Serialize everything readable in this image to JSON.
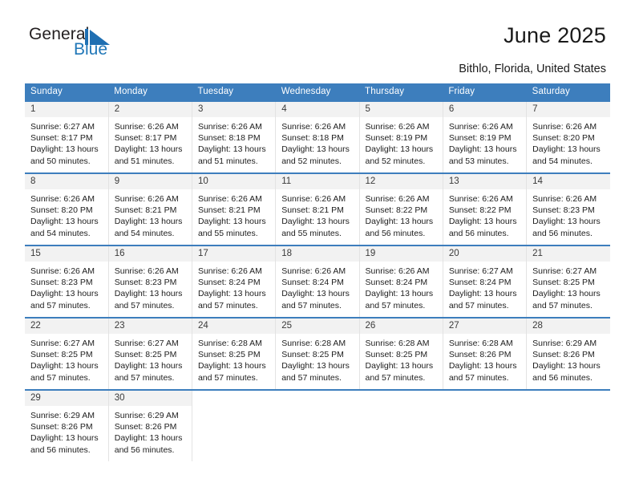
{
  "brand": {
    "word_general": "General",
    "word_blue": "Blue",
    "logo_icon": "triangle-flag-icon",
    "blue_hex": "#2077b8"
  },
  "header": {
    "title": "June 2025",
    "location": "Bithlo, Florida, United States",
    "header_bg_hex": "#3d7ebd",
    "daynum_bg_hex": "#f2f2f2"
  },
  "weekday_headers": [
    "Sunday",
    "Monday",
    "Tuesday",
    "Wednesday",
    "Thursday",
    "Friday",
    "Saturday"
  ],
  "weeks": [
    [
      {
        "day": "1",
        "sunrise": "Sunrise: 6:27 AM",
        "sunset": "Sunset: 8:17 PM",
        "daylight_1": "Daylight: 13 hours",
        "daylight_2": "and 50 minutes."
      },
      {
        "day": "2",
        "sunrise": "Sunrise: 6:26 AM",
        "sunset": "Sunset: 8:17 PM",
        "daylight_1": "Daylight: 13 hours",
        "daylight_2": "and 51 minutes."
      },
      {
        "day": "3",
        "sunrise": "Sunrise: 6:26 AM",
        "sunset": "Sunset: 8:18 PM",
        "daylight_1": "Daylight: 13 hours",
        "daylight_2": "and 51 minutes."
      },
      {
        "day": "4",
        "sunrise": "Sunrise: 6:26 AM",
        "sunset": "Sunset: 8:18 PM",
        "daylight_1": "Daylight: 13 hours",
        "daylight_2": "and 52 minutes."
      },
      {
        "day": "5",
        "sunrise": "Sunrise: 6:26 AM",
        "sunset": "Sunset: 8:19 PM",
        "daylight_1": "Daylight: 13 hours",
        "daylight_2": "and 52 minutes."
      },
      {
        "day": "6",
        "sunrise": "Sunrise: 6:26 AM",
        "sunset": "Sunset: 8:19 PM",
        "daylight_1": "Daylight: 13 hours",
        "daylight_2": "and 53 minutes."
      },
      {
        "day": "7",
        "sunrise": "Sunrise: 6:26 AM",
        "sunset": "Sunset: 8:20 PM",
        "daylight_1": "Daylight: 13 hours",
        "daylight_2": "and 54 minutes."
      }
    ],
    [
      {
        "day": "8",
        "sunrise": "Sunrise: 6:26 AM",
        "sunset": "Sunset: 8:20 PM",
        "daylight_1": "Daylight: 13 hours",
        "daylight_2": "and 54 minutes."
      },
      {
        "day": "9",
        "sunrise": "Sunrise: 6:26 AM",
        "sunset": "Sunset: 8:21 PM",
        "daylight_1": "Daylight: 13 hours",
        "daylight_2": "and 54 minutes."
      },
      {
        "day": "10",
        "sunrise": "Sunrise: 6:26 AM",
        "sunset": "Sunset: 8:21 PM",
        "daylight_1": "Daylight: 13 hours",
        "daylight_2": "and 55 minutes."
      },
      {
        "day": "11",
        "sunrise": "Sunrise: 6:26 AM",
        "sunset": "Sunset: 8:21 PM",
        "daylight_1": "Daylight: 13 hours",
        "daylight_2": "and 55 minutes."
      },
      {
        "day": "12",
        "sunrise": "Sunrise: 6:26 AM",
        "sunset": "Sunset: 8:22 PM",
        "daylight_1": "Daylight: 13 hours",
        "daylight_2": "and 56 minutes."
      },
      {
        "day": "13",
        "sunrise": "Sunrise: 6:26 AM",
        "sunset": "Sunset: 8:22 PM",
        "daylight_1": "Daylight: 13 hours",
        "daylight_2": "and 56 minutes."
      },
      {
        "day": "14",
        "sunrise": "Sunrise: 6:26 AM",
        "sunset": "Sunset: 8:23 PM",
        "daylight_1": "Daylight: 13 hours",
        "daylight_2": "and 56 minutes."
      }
    ],
    [
      {
        "day": "15",
        "sunrise": "Sunrise: 6:26 AM",
        "sunset": "Sunset: 8:23 PM",
        "daylight_1": "Daylight: 13 hours",
        "daylight_2": "and 57 minutes."
      },
      {
        "day": "16",
        "sunrise": "Sunrise: 6:26 AM",
        "sunset": "Sunset: 8:23 PM",
        "daylight_1": "Daylight: 13 hours",
        "daylight_2": "and 57 minutes."
      },
      {
        "day": "17",
        "sunrise": "Sunrise: 6:26 AM",
        "sunset": "Sunset: 8:24 PM",
        "daylight_1": "Daylight: 13 hours",
        "daylight_2": "and 57 minutes."
      },
      {
        "day": "18",
        "sunrise": "Sunrise: 6:26 AM",
        "sunset": "Sunset: 8:24 PM",
        "daylight_1": "Daylight: 13 hours",
        "daylight_2": "and 57 minutes."
      },
      {
        "day": "19",
        "sunrise": "Sunrise: 6:26 AM",
        "sunset": "Sunset: 8:24 PM",
        "daylight_1": "Daylight: 13 hours",
        "daylight_2": "and 57 minutes."
      },
      {
        "day": "20",
        "sunrise": "Sunrise: 6:27 AM",
        "sunset": "Sunset: 8:24 PM",
        "daylight_1": "Daylight: 13 hours",
        "daylight_2": "and 57 minutes."
      },
      {
        "day": "21",
        "sunrise": "Sunrise: 6:27 AM",
        "sunset": "Sunset: 8:25 PM",
        "daylight_1": "Daylight: 13 hours",
        "daylight_2": "and 57 minutes."
      }
    ],
    [
      {
        "day": "22",
        "sunrise": "Sunrise: 6:27 AM",
        "sunset": "Sunset: 8:25 PM",
        "daylight_1": "Daylight: 13 hours",
        "daylight_2": "and 57 minutes."
      },
      {
        "day": "23",
        "sunrise": "Sunrise: 6:27 AM",
        "sunset": "Sunset: 8:25 PM",
        "daylight_1": "Daylight: 13 hours",
        "daylight_2": "and 57 minutes."
      },
      {
        "day": "24",
        "sunrise": "Sunrise: 6:28 AM",
        "sunset": "Sunset: 8:25 PM",
        "daylight_1": "Daylight: 13 hours",
        "daylight_2": "and 57 minutes."
      },
      {
        "day": "25",
        "sunrise": "Sunrise: 6:28 AM",
        "sunset": "Sunset: 8:25 PM",
        "daylight_1": "Daylight: 13 hours",
        "daylight_2": "and 57 minutes."
      },
      {
        "day": "26",
        "sunrise": "Sunrise: 6:28 AM",
        "sunset": "Sunset: 8:25 PM",
        "daylight_1": "Daylight: 13 hours",
        "daylight_2": "and 57 minutes."
      },
      {
        "day": "27",
        "sunrise": "Sunrise: 6:28 AM",
        "sunset": "Sunset: 8:26 PM",
        "daylight_1": "Daylight: 13 hours",
        "daylight_2": "and 57 minutes."
      },
      {
        "day": "28",
        "sunrise": "Sunrise: 6:29 AM",
        "sunset": "Sunset: 8:26 PM",
        "daylight_1": "Daylight: 13 hours",
        "daylight_2": "and 56 minutes."
      }
    ],
    [
      {
        "day": "29",
        "sunrise": "Sunrise: 6:29 AM",
        "sunset": "Sunset: 8:26 PM",
        "daylight_1": "Daylight: 13 hours",
        "daylight_2": "and 56 minutes."
      },
      {
        "day": "30",
        "sunrise": "Sunrise: 6:29 AM",
        "sunset": "Sunset: 8:26 PM",
        "daylight_1": "Daylight: 13 hours",
        "daylight_2": "and 56 minutes."
      },
      {
        "day": "",
        "sunrise": "",
        "sunset": "",
        "daylight_1": "",
        "daylight_2": ""
      },
      {
        "day": "",
        "sunrise": "",
        "sunset": "",
        "daylight_1": "",
        "daylight_2": ""
      },
      {
        "day": "",
        "sunrise": "",
        "sunset": "",
        "daylight_1": "",
        "daylight_2": ""
      },
      {
        "day": "",
        "sunrise": "",
        "sunset": "",
        "daylight_1": "",
        "daylight_2": ""
      },
      {
        "day": "",
        "sunrise": "",
        "sunset": "",
        "daylight_1": "",
        "daylight_2": ""
      }
    ]
  ]
}
